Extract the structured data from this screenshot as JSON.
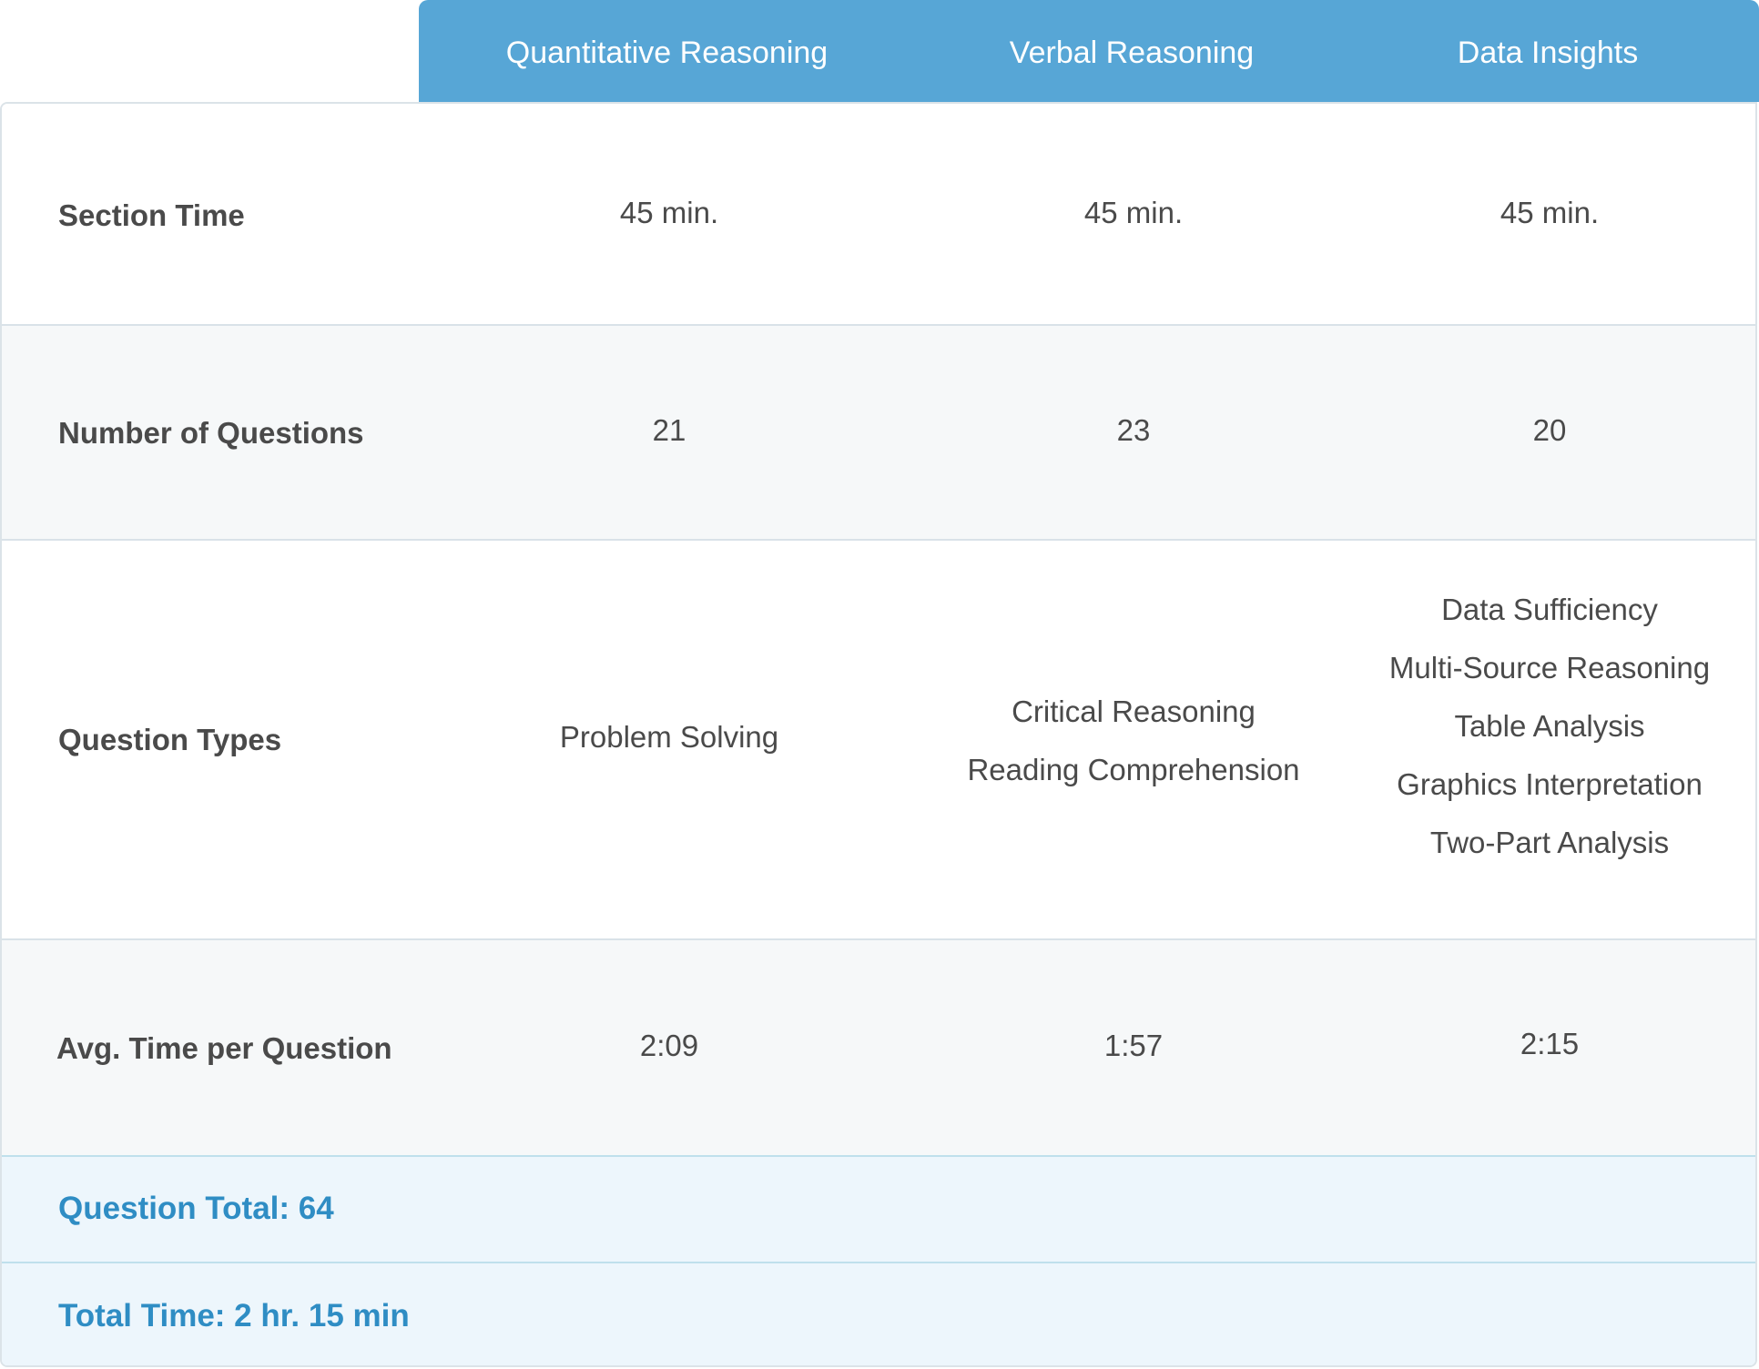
{
  "header": {
    "columns": [
      "Quantitative Reasoning",
      "Verbal Reasoning",
      "Data Insights"
    ]
  },
  "rows": [
    {
      "label": "Section Time",
      "values": [
        [
          "45 min."
        ],
        [
          "45 min."
        ],
        [
          "45 min."
        ]
      ]
    },
    {
      "label": "Number of Questions",
      "values": [
        [
          "21"
        ],
        [
          "23"
        ],
        [
          "20"
        ]
      ]
    },
    {
      "label": "Question Types",
      "values": [
        [
          "Problem Solving"
        ],
        [
          "Critical Reasoning",
          "Reading Comprehension"
        ],
        [
          "Data Sufficiency",
          "Multi-Source Reasoning",
          "Table Analysis",
          "Graphics Interpretation",
          "Two-Part Analysis"
        ]
      ]
    },
    {
      "label": "Avg. Time per Question",
      "values": [
        [
          "2:09"
        ],
        [
          "1:57"
        ],
        [
          "2:15"
        ]
      ]
    }
  ],
  "totals": {
    "question_total": "Question Total: 64",
    "total_time": "Total Time: 2 hr. 15 min"
  },
  "colors": {
    "header_bg": "#57a6d6",
    "total_text": "#2f8dc4",
    "total_bg": "#edf6fc",
    "alt_row_bg": "#f6f8f9"
  }
}
